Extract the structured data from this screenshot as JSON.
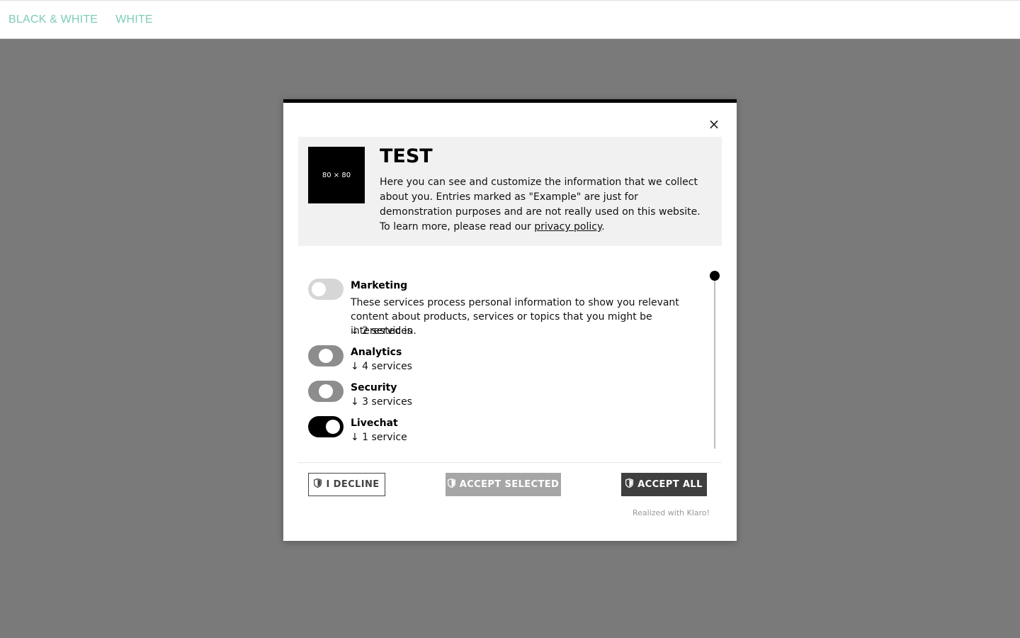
{
  "nav": {
    "links": [
      "BLACK & WHITE",
      "WHITE"
    ]
  },
  "modal": {
    "close_icon": "×",
    "logo_text": "80 × 80",
    "title": "TEST",
    "description_before": "Here you can see and customize the information that we collect about you. Entries marked as \"Example\" are just for demonstration purposes and are not really used on this website. To learn more, please read our ",
    "privacy_link": "privacy policy",
    "description_after": ".",
    "purposes": [
      {
        "title": "Marketing",
        "description": "These services process personal information to show you relevant content about products, services or topics that you might be interested in.",
        "count": "↓ 2 services",
        "state": "off"
      },
      {
        "title": "Analytics",
        "description": "",
        "count": "↓ 4 services",
        "state": "partial"
      },
      {
        "title": "Security",
        "description": "",
        "count": "↓ 3 services",
        "state": "partial"
      },
      {
        "title": "Livechat",
        "description": "",
        "count": "↓ 1 service",
        "state": "on"
      }
    ],
    "buttons": {
      "decline": "I DECLINE",
      "accept_selected": "ACCEPT SELECTED",
      "accept_all": "ACCEPT ALL"
    },
    "powered_by": "Realized with Klaro!"
  },
  "colors": {
    "nav_link": "#7fcbb8",
    "overlay": "#7a7a7a",
    "accent": "#000000"
  }
}
